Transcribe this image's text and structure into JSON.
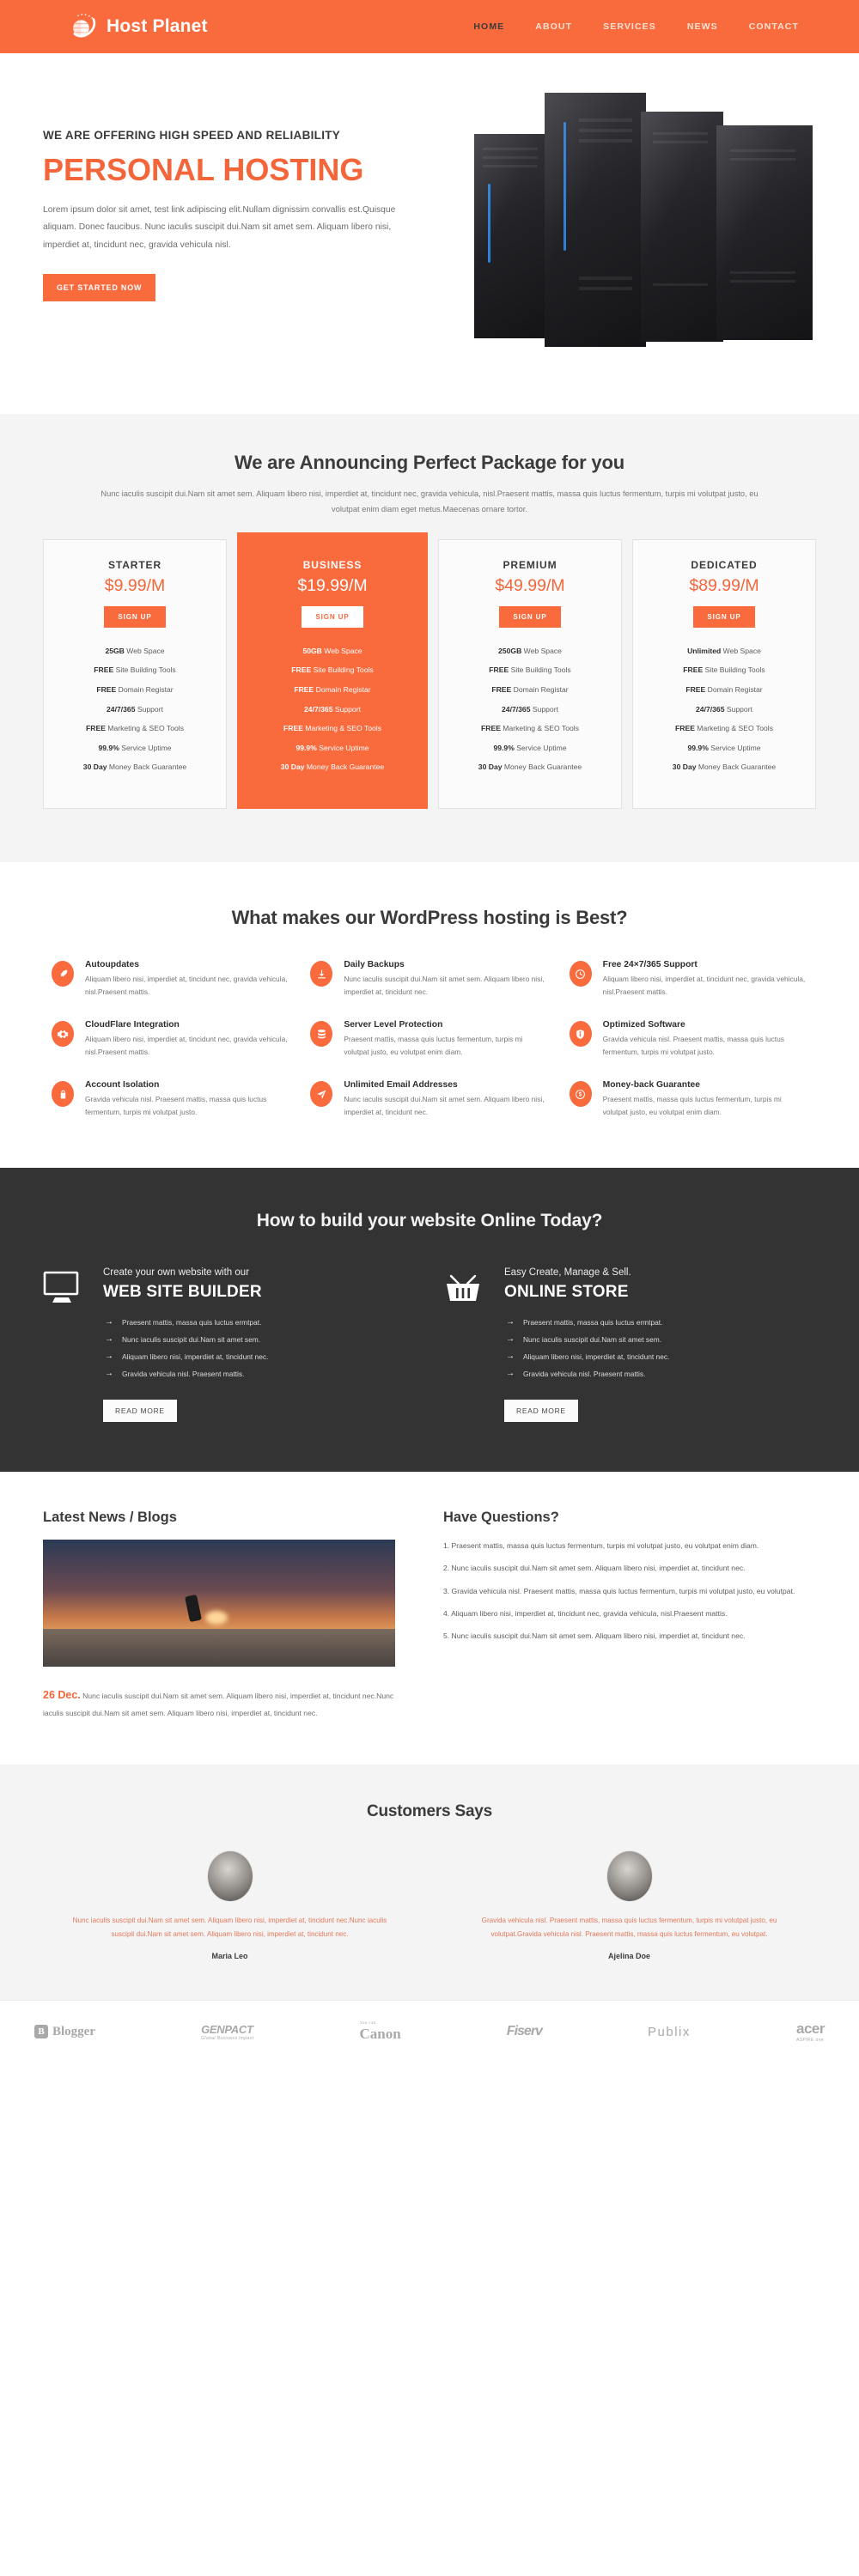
{
  "header": {
    "brand": "Host Planet",
    "logo_icon": "planet-swoosh-icon",
    "nav": [
      {
        "label": "HOME",
        "active": true
      },
      {
        "label": "ABOUT",
        "active": false
      },
      {
        "label": "SERVICES",
        "active": false
      },
      {
        "label": "NEWS",
        "active": false
      },
      {
        "label": "CONTACT",
        "active": false
      }
    ]
  },
  "hero": {
    "kicker": "WE ARE OFFERING HIGH SPEED AND RELIABILITY",
    "title": "PERSONAL HOSTING",
    "text": "Lorem ipsum dolor sit amet, test link adipiscing elit.Nullam dignissim convallis est.Quisque aliquam. Donec faucibus. Nunc iaculis suscipit dui.Nam sit amet sem. Aliquam libero nisi, imperdiet at, tincidunt nec, gravida vehicula nisl.",
    "cta": "GET STARTED NOW",
    "art": "server-racks-image"
  },
  "pricing": {
    "title": "We are Announcing Perfect Package for you",
    "subtitle": "Nunc iaculis suscipit dui.Nam sit amet sem. Aliquam libero nisi, imperdiet at, tincidunt nec, gravida vehicula, nisl.Praesent mattis, massa quis luctus fermentum, turpis mi volutpat justo, eu volutpat enim diam eget metus.Maecenas ornare tortor.",
    "cta_label": "SIGN UP",
    "plans": [
      {
        "name": "STARTER",
        "price": "$9.99/M",
        "featured": false,
        "features": [
          {
            "strong": "25GB",
            "rest": " Web Space"
          },
          {
            "strong": "FREE",
            "rest": " Site Building Tools"
          },
          {
            "strong": "FREE",
            "rest": " Domain Registar"
          },
          {
            "strong": "24/7/365",
            "rest": " Support"
          },
          {
            "strong": "FREE",
            "rest": " Marketing & SEO Tools"
          },
          {
            "strong": "99.9%",
            "rest": " Service Uptime"
          },
          {
            "strong": "30 Day",
            "rest": " Money Back Guarantee"
          }
        ]
      },
      {
        "name": "BUSINESS",
        "price": "$19.99/M",
        "featured": true,
        "features": [
          {
            "strong": "50GB",
            "rest": " Web Space"
          },
          {
            "strong": "FREE",
            "rest": " Site Building Tools"
          },
          {
            "strong": "FREE",
            "rest": " Domain Registar"
          },
          {
            "strong": "24/7/365",
            "rest": " Support"
          },
          {
            "strong": "FREE",
            "rest": " Marketing & SEO Tools"
          },
          {
            "strong": "99.9%",
            "rest": " Service Uptime"
          },
          {
            "strong": "30 Day",
            "rest": " Money Back Guarantee"
          }
        ]
      },
      {
        "name": "PREMIUM",
        "price": "$49.99/M",
        "featured": false,
        "features": [
          {
            "strong": "250GB",
            "rest": " Web Space"
          },
          {
            "strong": "FREE",
            "rest": " Site Building Tools"
          },
          {
            "strong": "FREE",
            "rest": " Domain Registar"
          },
          {
            "strong": "24/7/365",
            "rest": " Support"
          },
          {
            "strong": "FREE",
            "rest": " Marketing & SEO Tools"
          },
          {
            "strong": "99.9%",
            "rest": " Service Uptime"
          },
          {
            "strong": "30 Day",
            "rest": " Money Back Guarantee"
          }
        ]
      },
      {
        "name": "DEDICATED",
        "price": "$89.99/M",
        "featured": false,
        "features": [
          {
            "strong": "Unlimited",
            "rest": " Web Space"
          },
          {
            "strong": "FREE",
            "rest": " Site Building Tools"
          },
          {
            "strong": "FREE",
            "rest": " Domain Registar"
          },
          {
            "strong": "24/7/365",
            "rest": " Support"
          },
          {
            "strong": "FREE",
            "rest": " Marketing & SEO Tools"
          },
          {
            "strong": "99.9%",
            "rest": " Service Uptime"
          },
          {
            "strong": "30 Day",
            "rest": " Money Back Guarantee"
          }
        ]
      }
    ]
  },
  "features": {
    "title": "What makes our WordPress hosting is Best?",
    "items": [
      {
        "icon": "rocket-icon",
        "title": "Autoupdates",
        "text": "Aliquam libero nisi, imperdiet at, tincidunt nec, gravida vehicula, nisl.Praesent mattis."
      },
      {
        "icon": "download-icon",
        "title": "Daily Backups",
        "text": "Nunc iaculis suscipit dui.Nam sit amet sem. Aliquam libero nisi, imperdiet at, tincidunt nec."
      },
      {
        "icon": "clock-icon",
        "title": "Free 24×7/365 Support",
        "text": "Aliquam libero nisi, imperdiet at, tincidunt nec, gravida vehicula, nisl.Praesent mattis."
      },
      {
        "icon": "gear-icon",
        "title": "CloudFlare Integration",
        "text": "Aliquam libero nisi, imperdiet at, tincidunt nec, gravida vehicula, nisl.Praesent mattis."
      },
      {
        "icon": "database-icon",
        "title": "Server Level Protection",
        "text": "Praesent mattis, massa quis luctus fermentum, turpis mi volutpat justo, eu volutpat enim diam."
      },
      {
        "icon": "shield-icon",
        "title": "Optimized Software",
        "text": "Gravida vehicula nisl. Praesent mattis, massa quis luctus fermentum, turpis mi volutpat justo."
      },
      {
        "icon": "lock-icon",
        "title": "Account Isolation",
        "text": "Gravida vehicula nisl. Praesent mattis, massa quis luctus fermentum, turpis mi volutpat justo."
      },
      {
        "icon": "paper-plane-icon",
        "title": "Unlimited Email Addresses",
        "text": "Nunc iaculis suscipit dui.Nam sit amet sem. Aliquam libero nisi, imperdiet at, tincidunt nec."
      },
      {
        "icon": "money-icon",
        "title": "Money-back Guarantee",
        "text": "Praesent mattis, massa quis luctus fermentum, turpis mi volutpat justo, eu volutpat enim diam."
      }
    ]
  },
  "build": {
    "title": "How to build your website Online Today?",
    "read_more": "READ MORE",
    "columns": [
      {
        "icon": "monitor-icon",
        "kicker": "Create your own website with our",
        "heading": "WEB SITE BUILDER",
        "points": [
          "Praesent mattis, massa quis luctus ermtpat.",
          "Nunc iaculis suscipit dui.Nam sit amet sem.",
          "Aliquam libero nisi, imperdiet at, tincidunt nec.",
          "Gravida vehicula nisl. Praesent mattis."
        ]
      },
      {
        "icon": "shopping-basket-icon",
        "kicker": "Easy Create, Manage & Sell.",
        "heading": "ONLINE STORE",
        "points": [
          "Praesent mattis, massa quis luctus ermtpat.",
          "Nunc iaculis suscipit dui.Nam sit amet sem.",
          "Aliquam libero nisi, imperdiet at, tincidunt nec.",
          "Gravida vehicula nisl. Praesent mattis."
        ]
      }
    ]
  },
  "news": {
    "title": "Latest News / Blogs",
    "photo": "skateboarder-sunset-photo",
    "date": "26 Dec.",
    "excerpt": "Nunc iaculis suscipit dui.Nam sit amet sem. Aliquam libero nisi, imperdiet at, tincidunt nec.Nunc iaculis suscipit dui.Nam sit amet sem. Aliquam libero nisi, imperdiet at, tincidunt nec.",
    "questions_title": "Have Questions?",
    "questions": [
      "1. Praesent mattis, massa quis luctus fermentum, turpis mi volutpat justo, eu volutpat enim diam.",
      "2. Nunc iaculis suscipit dui.Nam sit amet sem. Aliquam libero nisi, imperdiet at, tincidunt nec.",
      "3. Gravida vehicula nisl. Praesent mattis, massa quis luctus fermentum, turpis mi volutpat justo, eu volutpat.",
      "4. Aliquam libero nisi, imperdiet at, tincidunt nec, gravida vehicula, nisl.Praesent mattis.",
      "5. Nunc iaculis suscipit dui.Nam sit amet sem. Aliquam libero nisi, imperdiet at, tincidunt nec."
    ]
  },
  "testimonials": {
    "title": "Customers Says",
    "items": [
      {
        "avatar": "woman-portrait-photo",
        "quote": "Nunc iaculis suscipit dui.Nam sit amet sem. Aliquam libero nisi, imperdiet at, tincidunt nec.Nunc iaculis suscipit dui.Nam sit amet sem. Aliquam libero nisi, imperdiet at, tincidunt nec.",
        "name": "Maria Leo"
      },
      {
        "avatar": "woman-headset-photo",
        "quote": "Gravida vehicula nisl. Praesent mattis, massa quis luctus fermentum, turpis mi volutpat justo, eu volutpat.Gravida vehicula nisl. Praesent mattis, massa quis luctus fermentum, eu volutpat.",
        "name": "Ajelina Doe"
      }
    ]
  },
  "logobar": {
    "logos": [
      {
        "name": "Blogger",
        "sub": ""
      },
      {
        "name": "GENPACT",
        "sub": "Global Business Impact"
      },
      {
        "name": "Canon",
        "sub": "You can"
      },
      {
        "name": "Fiserv",
        "sub": ""
      },
      {
        "name": "Publix",
        "sub": ""
      },
      {
        "name": "acer",
        "sub": "ASPIRE one"
      }
    ]
  },
  "colors": {
    "accent": "#f96a3d",
    "accent_text": "#f4663a",
    "dark": "#333333",
    "light_bg": "#f4f4f4"
  }
}
